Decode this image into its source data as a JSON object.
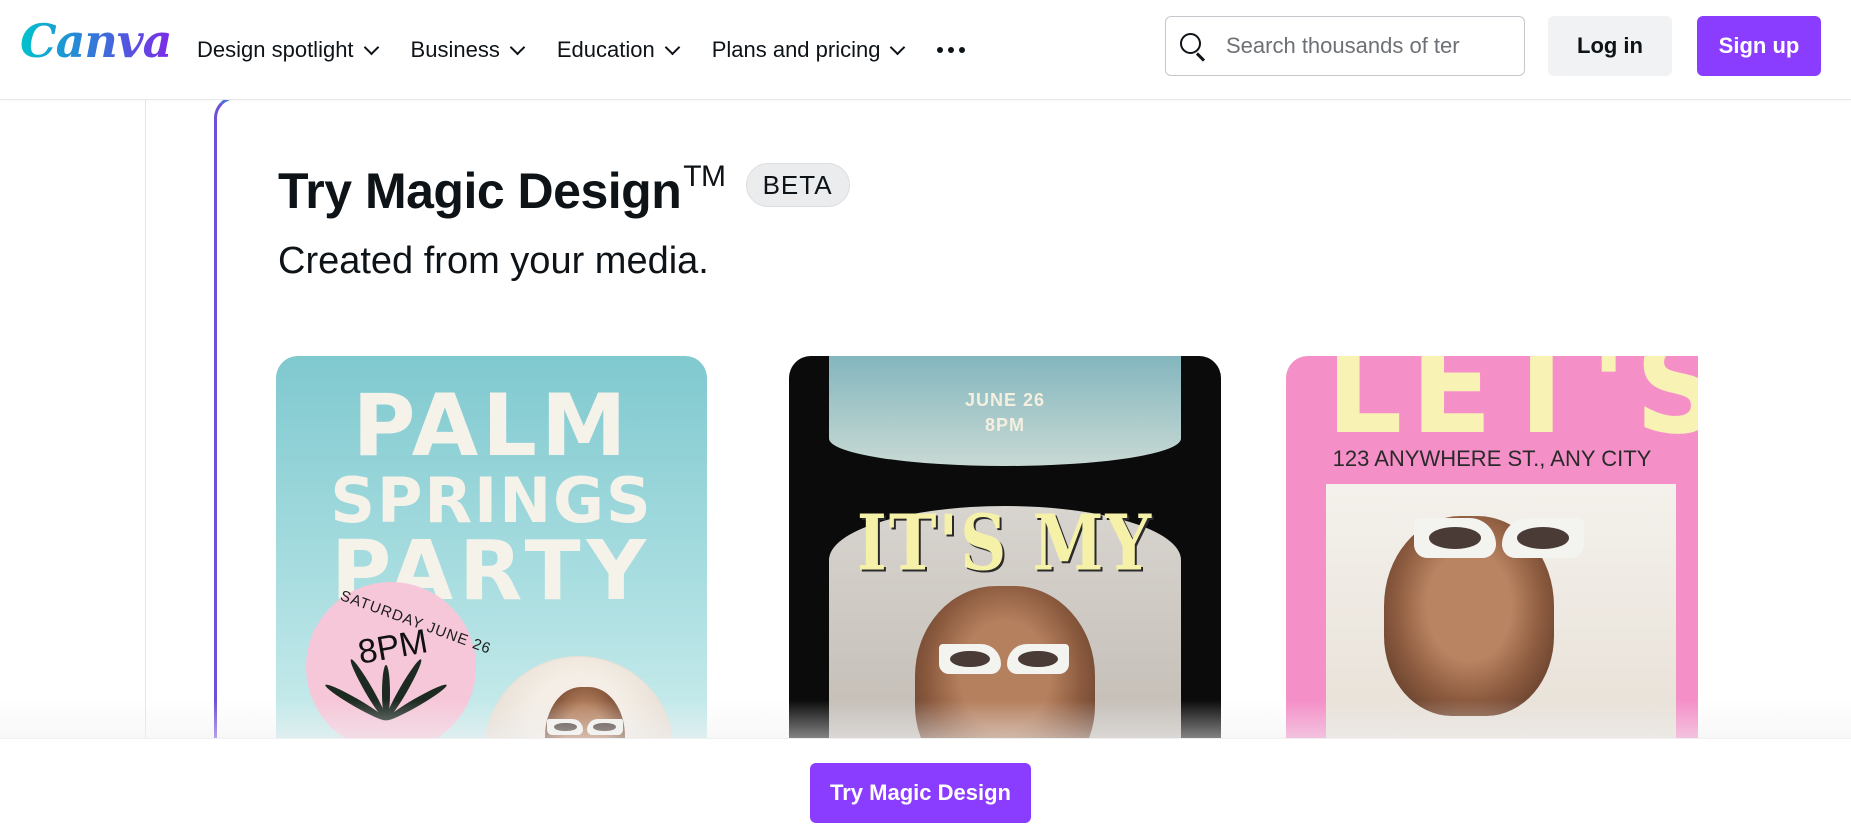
{
  "header": {
    "logo_text": "Canva",
    "nav": [
      {
        "label": "Design spotlight"
      },
      {
        "label": "Business"
      },
      {
        "label": "Education"
      },
      {
        "label": "Plans and pricing"
      }
    ],
    "more_icon": "more-horizontal-icon",
    "search": {
      "placeholder": "Search thousands of ter",
      "value": ""
    },
    "login_label": "Log in",
    "signup_label": "Sign up"
  },
  "hero": {
    "title": "Try Magic Design",
    "trademark": "TM",
    "badge": "BETA",
    "subtitle": "Created from your media."
  },
  "cards": [
    {
      "line1": "PALM",
      "line2": "SPRINGS",
      "line3": "PARTY",
      "date": "SATURDAY JUNE 26",
      "time": "8PM"
    },
    {
      "date": "JUNE 26",
      "time": "8PM",
      "headline": "IT'S MY"
    },
    {
      "headline": "LET'S",
      "address": "123 ANYWHERE ST., ANY CITY"
    }
  ],
  "cta": {
    "label": "Try Magic Design"
  },
  "colors": {
    "brand_purple": "#8b3dff",
    "logo_teal": "#00c4cc",
    "panel_border": "#6f4fd9"
  }
}
